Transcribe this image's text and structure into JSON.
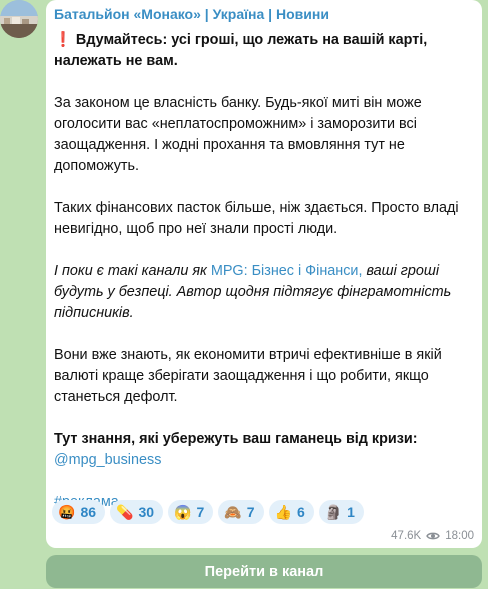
{
  "channel": {
    "name": "Батальйон «Монако» | Україна | Новини"
  },
  "post": {
    "headline_icon": "❗",
    "headline": "Вдумайтесь: усі гроші, що лежать на вашій карті, належать не вам.",
    "para2": "За законом це власність банку. Будь-якої миті він може оголосити вас «неплатоспроможним» і заморозити всі заощадження. І жодні прохання та вмовляння тут не допоможуть.",
    "para3": "Таких фінансових пасток більше, ніж здається. Просто владі невигідно, щоб про неї знали прості люди.",
    "para4_pre": "І поки є такі канали як ",
    "para4_link": "MPG: Бізнес і Фінанси,",
    "para4_post": " ваші гроші будуть у безпеці. Автор щодня підтягує фінграмотність підписників.",
    "para5": "Вони вже знають, як економити втричі ефективніше в якій валюті краще зберігати заощадження і що робити, якщо станеться дефолт.",
    "para6": "Тут знання, які убережуть ваш гаманець від кризи:",
    "handle": "@mpg_business",
    "hashtag": "#реклама"
  },
  "reactions": [
    {
      "emoji": "🤬",
      "count": "86"
    },
    {
      "emoji": "💊",
      "count": "30"
    },
    {
      "emoji": "😱",
      "count": "7"
    },
    {
      "emoji": "🙈",
      "count": "7"
    },
    {
      "emoji": "👍",
      "count": "6"
    },
    {
      "emoji": "🗿",
      "count": "1"
    }
  ],
  "meta": {
    "views": "47.6K",
    "time": "18:00",
    "views_icon": "eye-icon"
  },
  "button": {
    "label": "Перейти в канал"
  },
  "colors": {
    "accent": "#3a8ec4",
    "background": "#bfe0b3",
    "button": "#8fb891",
    "reaction_bg": "#e3f0fa"
  }
}
